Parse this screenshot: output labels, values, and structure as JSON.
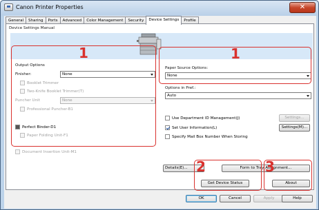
{
  "window": {
    "title": "Canon Printer Properties",
    "close_glyph": "✕"
  },
  "tabs": [
    {
      "label": "General"
    },
    {
      "label": "Sharing"
    },
    {
      "label": "Ports"
    },
    {
      "label": "Advanced"
    },
    {
      "label": "Color Management"
    },
    {
      "label": "Security"
    },
    {
      "label": "Device Settings",
      "active": true
    },
    {
      "label": "Profile"
    }
  ],
  "device_settings": {
    "section_title": "Device Settings Manual",
    "output_options": {
      "label": "Output Options",
      "finisher_label": "Finisher:",
      "finisher_value": "None",
      "booklet_trimmer": "Booklet Trimmer",
      "two_knife_trimmer": "Two-Knife Booklet Trimmer(T)",
      "puncher_unit_label": "Puncher Unit",
      "puncher_unit_value": "None",
      "professional_puncher": "Professional Puncher-B1",
      "perfect_binder": "Perfect Binder-D1",
      "paper_folding_unit": "Paper Folding Unit-F1",
      "document_insertion_unit": "Document Insertion Unit-M1"
    },
    "paper_source": {
      "label": "Paper Source Options:",
      "value": "None"
    },
    "options_in_pref": {
      "label": "Options in Pref.:",
      "value": "Auto"
    },
    "department_id": {
      "label": "Use Department ID Management(J)",
      "settings_button": "Settings..."
    },
    "user_information": {
      "label": "Set User Information(L)",
      "settings_button": "Settings(M)..."
    },
    "mailbox": {
      "label": "Specify Mail Box Number When Storing"
    }
  },
  "callouts": {
    "box1_number": "1",
    "box2_number": "2",
    "box3_number": "3"
  },
  "bottom_buttons": {
    "details": "Details(E)...",
    "form_to_tray": "Form to Tray Assignment...",
    "get_device_status": "Get Device Status",
    "about": "About"
  },
  "dialog_buttons": {
    "ok": "OK",
    "cancel": "Cancel",
    "apply": "Apply",
    "help": "Help"
  },
  "colors": {
    "callout_red": "#d9312d",
    "banner_blue": "#d7e8f8"
  }
}
